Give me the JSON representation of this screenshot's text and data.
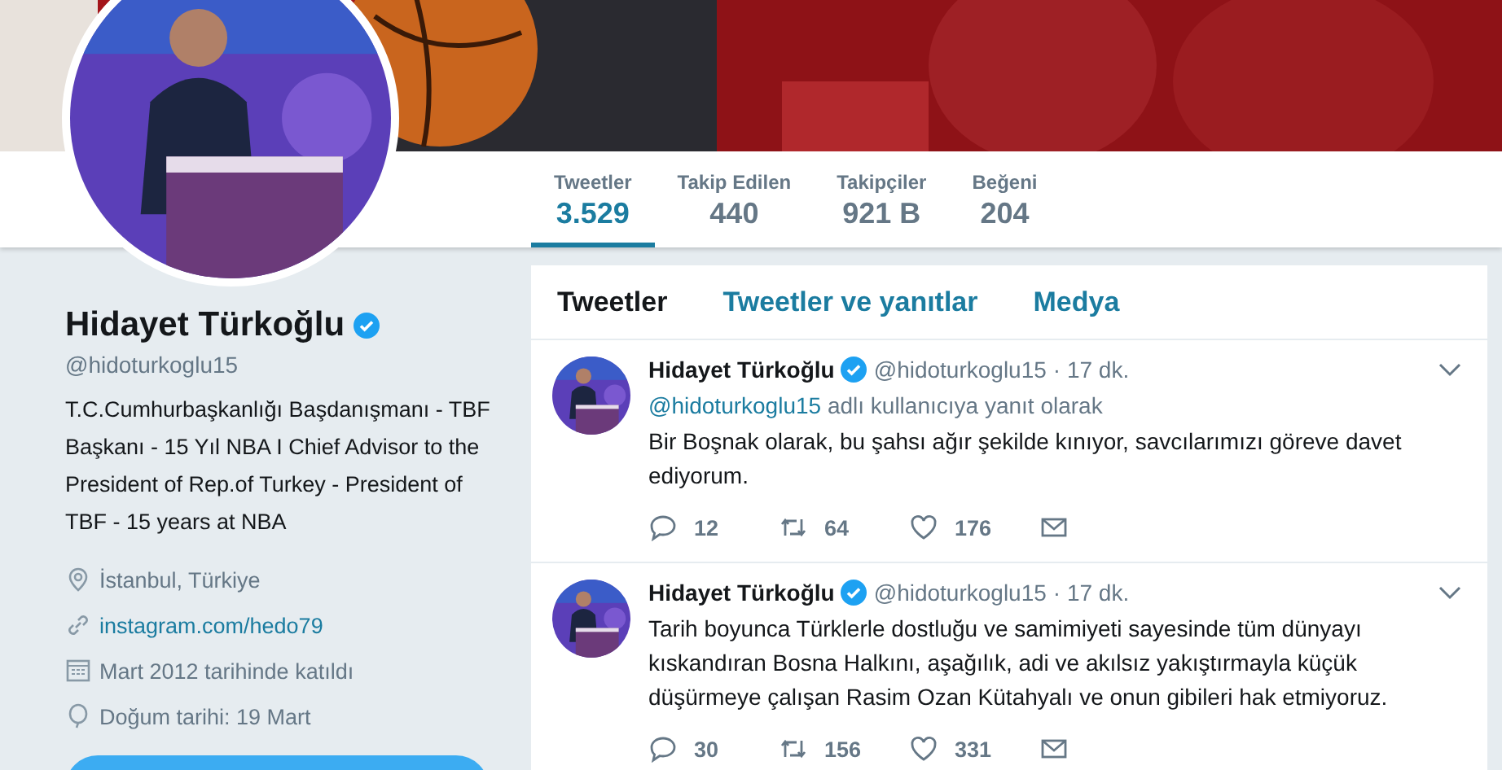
{
  "stats": [
    {
      "label": "Tweetler",
      "value": "3.529",
      "selected": true
    },
    {
      "label": "Takip Edilen",
      "value": "440",
      "selected": false
    },
    {
      "label": "Takipçiler",
      "value": "921 B",
      "selected": false
    },
    {
      "label": "Beğeni",
      "value": "204",
      "selected": false
    }
  ],
  "profile": {
    "name": "Hidayet Türkoğlu",
    "verified": true,
    "handle": "@hidoturkoglu15",
    "bio": "T.C.Cumhurbaşkanlığı Başdanışmanı - TBF Başkanı - 15 Yıl NBA I Chief Advisor to the President of Rep.of Turkey - President of TBF - 15 years at NBA",
    "details": [
      {
        "kind": "location",
        "text": "İstanbul, Türkiye"
      },
      {
        "kind": "link",
        "text": "instagram.com/hedo79"
      },
      {
        "kind": "joined",
        "text": "Mart 2012 tarihinde katıldı"
      },
      {
        "kind": "birthday",
        "text": "Doğum tarihi: 19 Mart"
      }
    ]
  },
  "timeline_tabs": [
    {
      "label": "Tweetler",
      "selected": true
    },
    {
      "label": "Tweetler ve yanıtlar",
      "selected": false
    },
    {
      "label": "Medya",
      "selected": false
    }
  ],
  "tweets": [
    {
      "name": "Hidayet Türkoğlu",
      "verified": true,
      "handle": "@hidoturkoglu15",
      "time": "· 17 dk.",
      "reply_to": {
        "handle": "@hidoturkoglu15",
        "text": "adlı kullanıcıya yanıt olarak"
      },
      "text": "Bir Boşnak olarak, bu şahsı ağır şekilde kınıyor, savcılarımızı göreve davet ediyorum.",
      "replies": "12",
      "retweets": "64",
      "likes": "176"
    },
    {
      "name": "Hidayet Türkoğlu",
      "verified": true,
      "handle": "@hidoturkoglu15",
      "time": "· 17 dk.",
      "text": "Tarih boyunca Türklerle dostluğu ve samimiyeti sayesinde tüm dünyayı kıskandıran Bosna Halkını, aşağılık, adi ve akılsız yakıştırmayla küçük düşürmeye çalışan Rasim Ozan Kütahyalı ve onun gibileri hak etmiyoruz.",
      "replies": "30",
      "retweets": "156",
      "likes": "331"
    }
  ]
}
